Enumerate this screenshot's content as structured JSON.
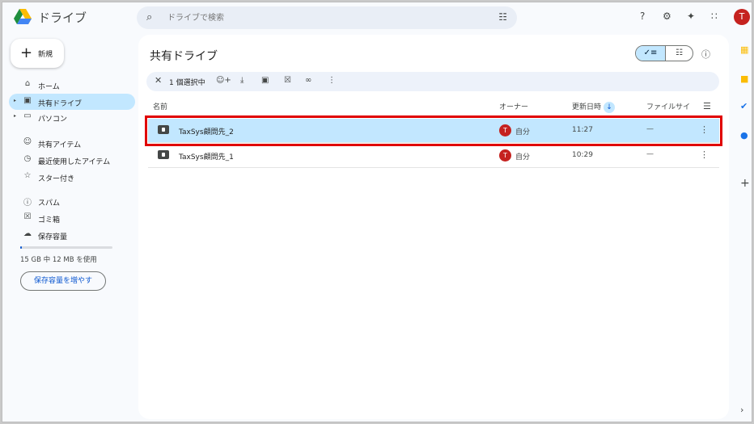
{
  "app": {
    "name": "ドライブ"
  },
  "search": {
    "placeholder": "ドライブで検索"
  },
  "topbar_icons": [
    "help-icon",
    "settings-icon",
    "gemini-icon",
    "apps-icon"
  ],
  "account": {
    "initial": "T"
  },
  "sidebar": {
    "new_label": "新規",
    "items": [
      {
        "label": "ホーム",
        "icon": "home-icon",
        "active": false
      },
      {
        "label": "共有ドライブ",
        "icon": "shared-drive-icon",
        "active": true
      },
      {
        "label": "パソコン",
        "icon": "computer-icon",
        "active": false
      },
      {
        "label": "共有アイテム",
        "icon": "people-icon",
        "active": false
      },
      {
        "label": "最近使用したアイテム",
        "icon": "clock-icon",
        "active": false
      },
      {
        "label": "スター付き",
        "icon": "star-icon",
        "active": false
      },
      {
        "label": "スパム",
        "icon": "spam-icon",
        "active": false
      },
      {
        "label": "ゴミ箱",
        "icon": "trash-icon",
        "active": false
      },
      {
        "label": "保存容量",
        "icon": "cloud-icon",
        "active": false
      }
    ],
    "storage_text": "15 GB 中 12 MB を使用",
    "storage_used_fraction": 0.01,
    "more_storage_label": "保存容量を増やす"
  },
  "main": {
    "title": "共有ドライブ",
    "selection": {
      "count_label": "1 個選択中"
    },
    "columns": {
      "name": "名前",
      "owner": "オーナー",
      "modified": "更新日時",
      "size": "ファイルサイ"
    },
    "rows": [
      {
        "name": "TaxSys顧問先_2",
        "owner_initial": "T",
        "owner": "自分",
        "modified": "11:27",
        "size": "—",
        "selected": true
      },
      {
        "name": "TaxSys顧問先_1",
        "owner_initial": "T",
        "owner": "自分",
        "modified": "10:29",
        "size": "—",
        "selected": false
      }
    ]
  },
  "colors": {
    "accent": "#0b57d0",
    "selected_bg": "#c2e7ff",
    "highlight": "#e00000",
    "avatar": "#c5221f"
  }
}
